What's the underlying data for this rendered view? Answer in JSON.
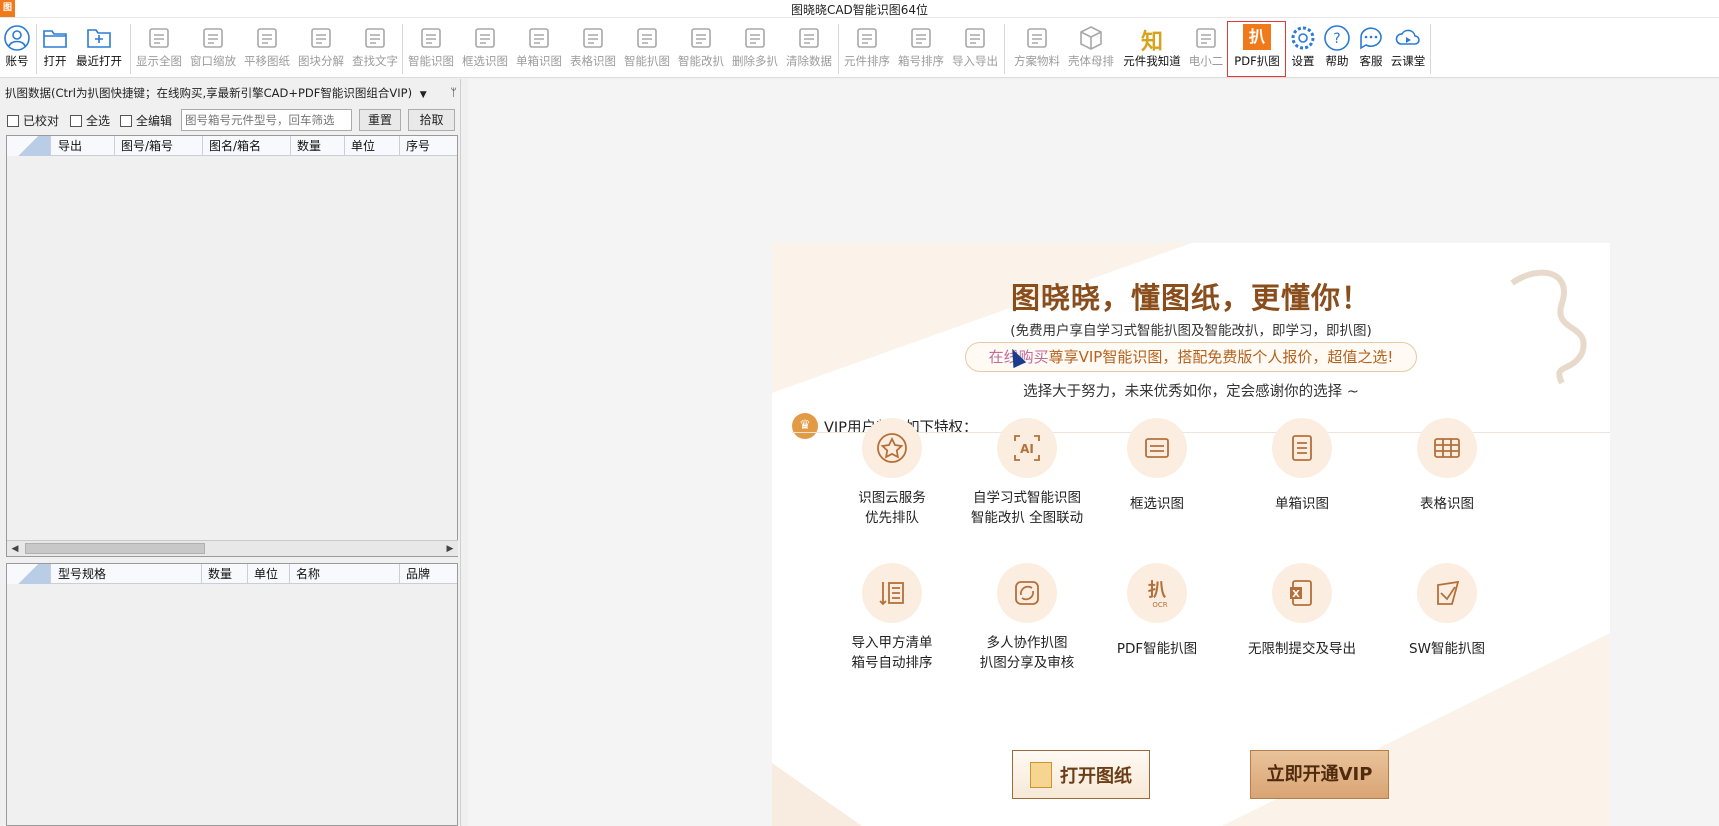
{
  "window": {
    "title": "图晓晓CAD智能识图64位",
    "app_icon_text": "图"
  },
  "toolbar": {
    "items": [
      {
        "label": "账号",
        "icon": "user-icon"
      },
      {
        "label": "打开",
        "icon": "folder-open-icon"
      },
      {
        "label": "最近打开",
        "icon": "recent-folder-icon"
      },
      {
        "label": "显示全图",
        "icon": "fit-all-icon"
      },
      {
        "label": "窗口缩放",
        "icon": "zoom-window-icon"
      },
      {
        "label": "平移图纸",
        "icon": "pan-icon"
      },
      {
        "label": "图块分解",
        "icon": "explode-block-icon"
      },
      {
        "label": "查找文字",
        "icon": "find-text-icon"
      },
      {
        "label": "智能识图",
        "icon": "ai-recognize-icon"
      },
      {
        "label": "框选识图",
        "icon": "box-select-icon"
      },
      {
        "label": "单箱识图",
        "icon": "single-box-icon"
      },
      {
        "label": "表格识图",
        "icon": "table-recognize-icon"
      },
      {
        "label": "智能扒图",
        "icon": "smart-extract-icon"
      },
      {
        "label": "智能改扒",
        "icon": "smart-modify-icon"
      },
      {
        "label": "删除多扒",
        "icon": "eraser-icon"
      },
      {
        "label": "清除数据",
        "icon": "clear-data-icon"
      },
      {
        "label": "元件排序",
        "icon": "sort-component-icon"
      },
      {
        "label": "箱号排序",
        "icon": "sort-box-icon"
      },
      {
        "label": "导入导出",
        "icon": "import-export-icon"
      },
      {
        "label": "方案物料",
        "icon": "material-icon"
      },
      {
        "label": "壳体母排",
        "icon": "cube-icon"
      },
      {
        "label": "元件我知道",
        "icon": "know-icon",
        "glyph": "知"
      },
      {
        "label": "电小二",
        "icon": "dianxiaoer-icon"
      },
      {
        "label": "PDF扒图",
        "icon": "pdf-extract-icon",
        "glyph": "扒"
      },
      {
        "label": "设置",
        "icon": "gear-icon"
      },
      {
        "label": "帮助",
        "icon": "help-icon"
      },
      {
        "label": "客服",
        "icon": "chat-icon"
      },
      {
        "label": "云课堂",
        "icon": "cloud-class-icon"
      }
    ]
  },
  "left_panel": {
    "header": "扒图数据(Ctrl为扒图快捷键；在线购买,享最新引擎CAD+PDF智能识图组合VIP)",
    "header_dropdown": "▼",
    "header_pin": "ᛘ",
    "checkboxes": [
      "已校对",
      "全选",
      "全编辑"
    ],
    "search_placeholder": "图号箱号元件型号，回车筛选",
    "reset_label": "重置",
    "pick_label": "拾取",
    "grid1_columns": [
      "导出",
      "图号/箱号",
      "图名/箱名",
      "数量",
      "单位",
      "序号"
    ],
    "grid2_columns": [
      "型号规格",
      "数量",
      "单位",
      "名称",
      "品牌"
    ]
  },
  "promo": {
    "title": "图晓晓，懂图纸，更懂你！",
    "subtitle": "(免费用户享自学习式智能扒图及智能改扒，即学习，即扒图)",
    "pill_lead": "在线购买",
    "pill_rest": "尊享VIP智能识图，搭配免费版个人报价，超值之选!",
    "tagline": "选择大于努力，未来优秀如你，定会感谢你的选择 ~",
    "vip_header": "VIP用户尊享如下特权：",
    "crown_glyph": "♛",
    "features": [
      {
        "line1": "识图云服务",
        "line2": "优先排队",
        "icon": "star-icon"
      },
      {
        "line1": "自学习式智能识图",
        "line2": "智能改扒 全图联动",
        "icon": "ai-icon"
      },
      {
        "line1": "框选识图",
        "line2": "",
        "icon": "box-select-icon"
      },
      {
        "line1": "单箱识图",
        "line2": "",
        "icon": "single-box-icon"
      },
      {
        "line1": "表格识图",
        "line2": "",
        "icon": "table-icon"
      },
      {
        "line1": "导入甲方清单",
        "line2": "箱号自动排序",
        "icon": "list-import-icon"
      },
      {
        "line1": "多人协作扒图",
        "line2": "扒图分享及审核",
        "icon": "collaborate-icon"
      },
      {
        "line1": "PDF智能扒图",
        "line2": "",
        "icon": "ocr-icon"
      },
      {
        "line1": "无限制提交及导出",
        "line2": "",
        "icon": "excel-icon"
      },
      {
        "line1": "SW智能扒图",
        "line2": "",
        "icon": "sw-icon"
      }
    ],
    "ai_glyph": "AI",
    "ocr_glyph": "扒",
    "ocr_sub": "OCR",
    "excel_glyph": "X",
    "open_button": "打开图纸",
    "vip_button": "立即开通VIP"
  }
}
